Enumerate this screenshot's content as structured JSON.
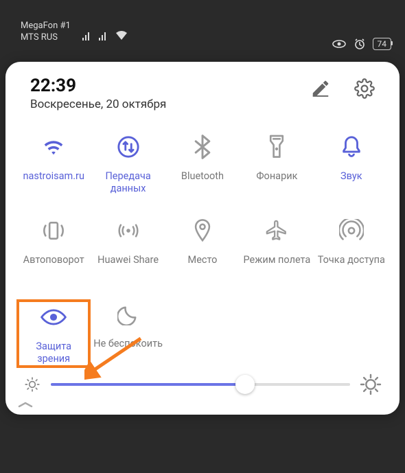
{
  "status_bar": {
    "carrier1": "MegaFon #1",
    "carrier2": "MTS RUS",
    "battery": "74"
  },
  "panel": {
    "time": "22:39",
    "date": "Воскресенье, 20 октября"
  },
  "tiles": {
    "wifi": {
      "label": "nastroisam.ru"
    },
    "data": {
      "label": "Передача данных"
    },
    "bluetooth": {
      "label": "Bluetooth"
    },
    "flashlight": {
      "label": "Фонарик"
    },
    "sound": {
      "label": "Звук"
    },
    "rotate": {
      "label": "Автоповорот"
    },
    "share": {
      "label": "Huawei Share"
    },
    "location": {
      "label": "Место"
    },
    "airplane": {
      "label": "Режим полета"
    },
    "hotspot": {
      "label": "Точка доступа"
    },
    "eyecomfort": {
      "label": "Защита зрения"
    },
    "dnd": {
      "label": "Не беспокоить"
    }
  },
  "accent_color": "#5961d8",
  "inactive_color": "#9a9a9a"
}
